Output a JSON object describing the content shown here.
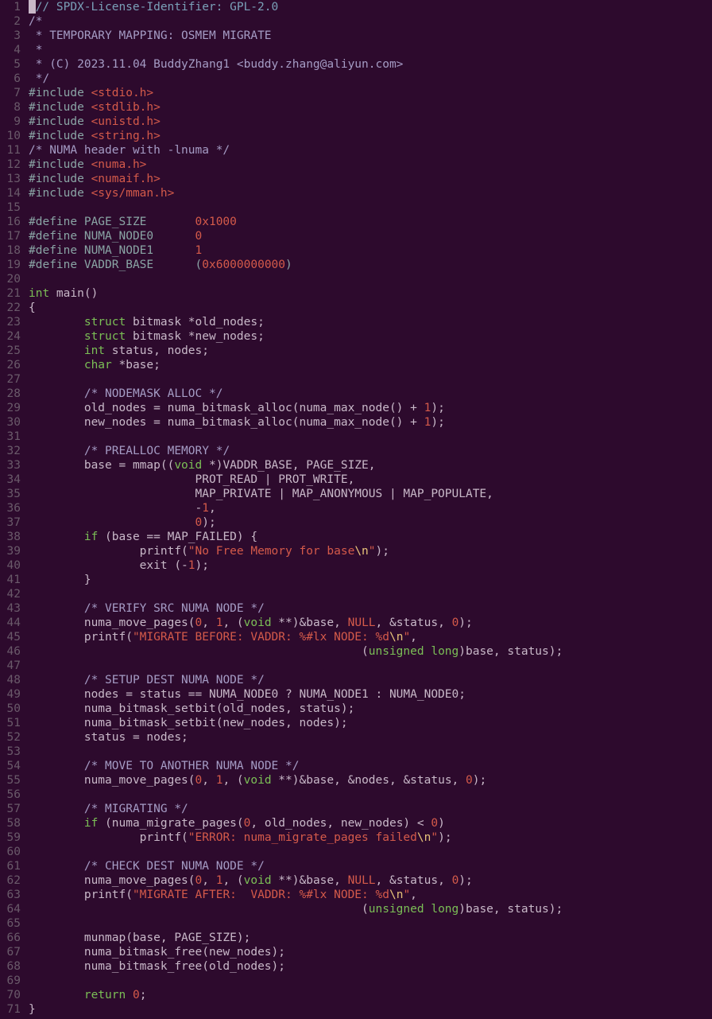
{
  "editor": {
    "language": "c",
    "theme": "dark-magenta",
    "cursor": {
      "line": 1,
      "col": 1
    }
  },
  "lines": [
    {
      "n": 1,
      "t": [
        [
          "cursor",
          ""
        ],
        [
          "c",
          "// SPDX-License-Identifier: GPL-2.0"
        ]
      ]
    },
    {
      "n": 2,
      "t": [
        [
          "cb",
          "/*"
        ]
      ]
    },
    {
      "n": 3,
      "t": [
        [
          "cb",
          " * TEMPORARY MAPPING: OSMEM MIGRATE"
        ]
      ]
    },
    {
      "n": 4,
      "t": [
        [
          "cb",
          " *"
        ]
      ]
    },
    {
      "n": 5,
      "t": [
        [
          "cb",
          " * (C) 2023.11.04 BuddyZhang1 <buddy.zhang@aliyun.com>"
        ]
      ]
    },
    {
      "n": 6,
      "t": [
        [
          "cb",
          " */"
        ]
      ]
    },
    {
      "n": 7,
      "t": [
        [
          "pp",
          "#include "
        ],
        [
          "hdr",
          "<stdio.h>"
        ]
      ]
    },
    {
      "n": 8,
      "t": [
        [
          "pp",
          "#include "
        ],
        [
          "hdr",
          "<stdlib.h>"
        ]
      ]
    },
    {
      "n": 9,
      "t": [
        [
          "pp",
          "#include "
        ],
        [
          "hdr",
          "<unistd.h>"
        ]
      ]
    },
    {
      "n": 10,
      "t": [
        [
          "pp",
          "#include "
        ],
        [
          "hdr",
          "<string.h>"
        ]
      ]
    },
    {
      "n": 11,
      "t": [
        [
          "cb",
          "/* NUMA header with -lnuma */"
        ]
      ]
    },
    {
      "n": 12,
      "t": [
        [
          "pp",
          "#include "
        ],
        [
          "hdr",
          "<numa.h>"
        ]
      ]
    },
    {
      "n": 13,
      "t": [
        [
          "pp",
          "#include "
        ],
        [
          "hdr",
          "<numaif.h>"
        ]
      ]
    },
    {
      "n": 14,
      "t": [
        [
          "pp",
          "#include "
        ],
        [
          "hdr",
          "<sys/mman.h>"
        ]
      ]
    },
    {
      "n": 15,
      "t": []
    },
    {
      "n": 16,
      "t": [
        [
          "pp",
          "#define PAGE_SIZE       "
        ],
        [
          "nm",
          "0x1000"
        ]
      ]
    },
    {
      "n": 17,
      "t": [
        [
          "pp",
          "#define NUMA_NODE0      "
        ],
        [
          "nm",
          "0"
        ]
      ]
    },
    {
      "n": 18,
      "t": [
        [
          "pp",
          "#define NUMA_NODE1      "
        ],
        [
          "nm",
          "1"
        ]
      ]
    },
    {
      "n": 19,
      "t": [
        [
          "pp",
          "#define VADDR_BASE      ("
        ],
        [
          "nm",
          "0x6000000000"
        ],
        [
          "pp",
          ")"
        ]
      ]
    },
    {
      "n": 20,
      "t": []
    },
    {
      "n": 21,
      "t": [
        [
          "ty",
          "int"
        ],
        [
          "pl",
          " main()"
        ]
      ]
    },
    {
      "n": 22,
      "t": [
        [
          "pl",
          "{"
        ]
      ]
    },
    {
      "n": 23,
      "t": [
        [
          "pl",
          "        "
        ],
        [
          "kw",
          "struct"
        ],
        [
          "pl",
          " bitmask *old_nodes;"
        ]
      ]
    },
    {
      "n": 24,
      "t": [
        [
          "pl",
          "        "
        ],
        [
          "kw",
          "struct"
        ],
        [
          "pl",
          " bitmask *new_nodes;"
        ]
      ]
    },
    {
      "n": 25,
      "t": [
        [
          "pl",
          "        "
        ],
        [
          "ty",
          "int"
        ],
        [
          "pl",
          " status, nodes;"
        ]
      ]
    },
    {
      "n": 26,
      "t": [
        [
          "pl",
          "        "
        ],
        [
          "ty",
          "char"
        ],
        [
          "pl",
          " *base;"
        ]
      ]
    },
    {
      "n": 27,
      "t": []
    },
    {
      "n": 28,
      "t": [
        [
          "pl",
          "        "
        ],
        [
          "cb",
          "/* NODEMASK ALLOC */"
        ]
      ]
    },
    {
      "n": 29,
      "t": [
        [
          "pl",
          "        old_nodes = numa_bitmask_alloc(numa_max_node() + "
        ],
        [
          "nm",
          "1"
        ],
        [
          "pl",
          ");"
        ]
      ]
    },
    {
      "n": 30,
      "t": [
        [
          "pl",
          "        new_nodes = numa_bitmask_alloc(numa_max_node() + "
        ],
        [
          "nm",
          "1"
        ],
        [
          "pl",
          ");"
        ]
      ]
    },
    {
      "n": 31,
      "t": []
    },
    {
      "n": 32,
      "t": [
        [
          "pl",
          "        "
        ],
        [
          "cb",
          "/* PREALLOC MEMORY */"
        ]
      ]
    },
    {
      "n": 33,
      "t": [
        [
          "pl",
          "        base = mmap(("
        ],
        [
          "ty",
          "void"
        ],
        [
          "pl",
          " *)VADDR_BASE, PAGE_SIZE,"
        ]
      ]
    },
    {
      "n": 34,
      "t": [
        [
          "pl",
          "                        PROT_READ | PROT_WRITE,"
        ]
      ]
    },
    {
      "n": 35,
      "t": [
        [
          "pl",
          "                        MAP_PRIVATE | MAP_ANONYMOUS | MAP_POPULATE,"
        ]
      ]
    },
    {
      "n": 36,
      "t": [
        [
          "pl",
          "                        -"
        ],
        [
          "nm",
          "1"
        ],
        [
          "pl",
          ","
        ]
      ]
    },
    {
      "n": 37,
      "t": [
        [
          "pl",
          "                        "
        ],
        [
          "nm",
          "0"
        ],
        [
          "pl",
          ");"
        ]
      ]
    },
    {
      "n": 38,
      "t": [
        [
          "pl",
          "        "
        ],
        [
          "kw",
          "if"
        ],
        [
          "pl",
          " (base == MAP_FAILED) {"
        ]
      ]
    },
    {
      "n": 39,
      "t": [
        [
          "pl",
          "                printf("
        ],
        [
          "st",
          "\"No Free Memory for base"
        ],
        [
          "esc",
          "\\n"
        ],
        [
          "st",
          "\""
        ],
        [
          "pl",
          ");"
        ]
      ]
    },
    {
      "n": 40,
      "t": [
        [
          "pl",
          "                exit (-"
        ],
        [
          "nm",
          "1"
        ],
        [
          "pl",
          ");"
        ]
      ]
    },
    {
      "n": 41,
      "t": [
        [
          "pl",
          "        }"
        ]
      ]
    },
    {
      "n": 42,
      "t": []
    },
    {
      "n": 43,
      "t": [
        [
          "pl",
          "        "
        ],
        [
          "cb",
          "/* VERIFY SRC NUMA NODE */"
        ]
      ]
    },
    {
      "n": 44,
      "t": [
        [
          "pl",
          "        numa_move_pages("
        ],
        [
          "nm",
          "0"
        ],
        [
          "pl",
          ", "
        ],
        [
          "nm",
          "1"
        ],
        [
          "pl",
          ", ("
        ],
        [
          "ty",
          "void"
        ],
        [
          "pl",
          " **)&base, "
        ],
        [
          "nm",
          "NULL"
        ],
        [
          "pl",
          ", &status, "
        ],
        [
          "nm",
          "0"
        ],
        [
          "pl",
          ");"
        ]
      ]
    },
    {
      "n": 45,
      "t": [
        [
          "pl",
          "        printf("
        ],
        [
          "st",
          "\"MIGRATE BEFORE: VADDR: %#lx NODE: %d"
        ],
        [
          "esc",
          "\\n"
        ],
        [
          "st",
          "\""
        ],
        [
          "pl",
          ","
        ]
      ]
    },
    {
      "n": 46,
      "t": [
        [
          "pl",
          "                                                ("
        ],
        [
          "ty",
          "unsigned long"
        ],
        [
          "pl",
          ")base, status);"
        ]
      ]
    },
    {
      "n": 47,
      "t": []
    },
    {
      "n": 48,
      "t": [
        [
          "pl",
          "        "
        ],
        [
          "cb",
          "/* SETUP DEST NUMA NODE */"
        ]
      ]
    },
    {
      "n": 49,
      "t": [
        [
          "pl",
          "        nodes = status == NUMA_NODE0 ? NUMA_NODE1 : NUMA_NODE0;"
        ]
      ]
    },
    {
      "n": 50,
      "t": [
        [
          "pl",
          "        numa_bitmask_setbit(old_nodes, status);"
        ]
      ]
    },
    {
      "n": 51,
      "t": [
        [
          "pl",
          "        numa_bitmask_setbit(new_nodes, nodes);"
        ]
      ]
    },
    {
      "n": 52,
      "t": [
        [
          "pl",
          "        status = nodes;"
        ]
      ]
    },
    {
      "n": 53,
      "t": []
    },
    {
      "n": 54,
      "t": [
        [
          "pl",
          "        "
        ],
        [
          "cb",
          "/* MOVE TO ANOTHER NUMA NODE */"
        ]
      ]
    },
    {
      "n": 55,
      "t": [
        [
          "pl",
          "        numa_move_pages("
        ],
        [
          "nm",
          "0"
        ],
        [
          "pl",
          ", "
        ],
        [
          "nm",
          "1"
        ],
        [
          "pl",
          ", ("
        ],
        [
          "ty",
          "void"
        ],
        [
          "pl",
          " **)&base, &nodes, &status, "
        ],
        [
          "nm",
          "0"
        ],
        [
          "pl",
          ");"
        ]
      ]
    },
    {
      "n": 56,
      "t": []
    },
    {
      "n": 57,
      "t": [
        [
          "pl",
          "        "
        ],
        [
          "cb",
          "/* MIGRATING */"
        ]
      ]
    },
    {
      "n": 58,
      "t": [
        [
          "pl",
          "        "
        ],
        [
          "kw",
          "if"
        ],
        [
          "pl",
          " (numa_migrate_pages("
        ],
        [
          "nm",
          "0"
        ],
        [
          "pl",
          ", old_nodes, new_nodes) < "
        ],
        [
          "nm",
          "0"
        ],
        [
          "pl",
          ")"
        ]
      ]
    },
    {
      "n": 59,
      "t": [
        [
          "pl",
          "                printf("
        ],
        [
          "st",
          "\"ERROR: numa_migrate_pages failed"
        ],
        [
          "esc",
          "\\n"
        ],
        [
          "st",
          "\""
        ],
        [
          "pl",
          ");"
        ]
      ]
    },
    {
      "n": 60,
      "t": []
    },
    {
      "n": 61,
      "t": [
        [
          "pl",
          "        "
        ],
        [
          "cb",
          "/* CHECK DEST NUMA NODE */"
        ]
      ]
    },
    {
      "n": 62,
      "t": [
        [
          "pl",
          "        numa_move_pages("
        ],
        [
          "nm",
          "0"
        ],
        [
          "pl",
          ", "
        ],
        [
          "nm",
          "1"
        ],
        [
          "pl",
          ", ("
        ],
        [
          "ty",
          "void"
        ],
        [
          "pl",
          " **)&base, "
        ],
        [
          "nm",
          "NULL"
        ],
        [
          "pl",
          ", &status, "
        ],
        [
          "nm",
          "0"
        ],
        [
          "pl",
          ");"
        ]
      ]
    },
    {
      "n": 63,
      "t": [
        [
          "pl",
          "        printf("
        ],
        [
          "st",
          "\"MIGRATE AFTER:  VADDR: %#lx NODE: %d"
        ],
        [
          "esc",
          "\\n"
        ],
        [
          "st",
          "\""
        ],
        [
          "pl",
          ","
        ]
      ]
    },
    {
      "n": 64,
      "t": [
        [
          "pl",
          "                                                ("
        ],
        [
          "ty",
          "unsigned long"
        ],
        [
          "pl",
          ")base, status);"
        ]
      ]
    },
    {
      "n": 65,
      "t": []
    },
    {
      "n": 66,
      "t": [
        [
          "pl",
          "        munmap(base, PAGE_SIZE);"
        ]
      ]
    },
    {
      "n": 67,
      "t": [
        [
          "pl",
          "        numa_bitmask_free(new_nodes);"
        ]
      ]
    },
    {
      "n": 68,
      "t": [
        [
          "pl",
          "        numa_bitmask_free(old_nodes);"
        ]
      ]
    },
    {
      "n": 69,
      "t": []
    },
    {
      "n": 70,
      "t": [
        [
          "pl",
          "        "
        ],
        [
          "kw",
          "return"
        ],
        [
          "pl",
          " "
        ],
        [
          "nm",
          "0"
        ],
        [
          "pl",
          ";"
        ]
      ]
    },
    {
      "n": 71,
      "t": [
        [
          "pl",
          "}"
        ]
      ]
    }
  ]
}
